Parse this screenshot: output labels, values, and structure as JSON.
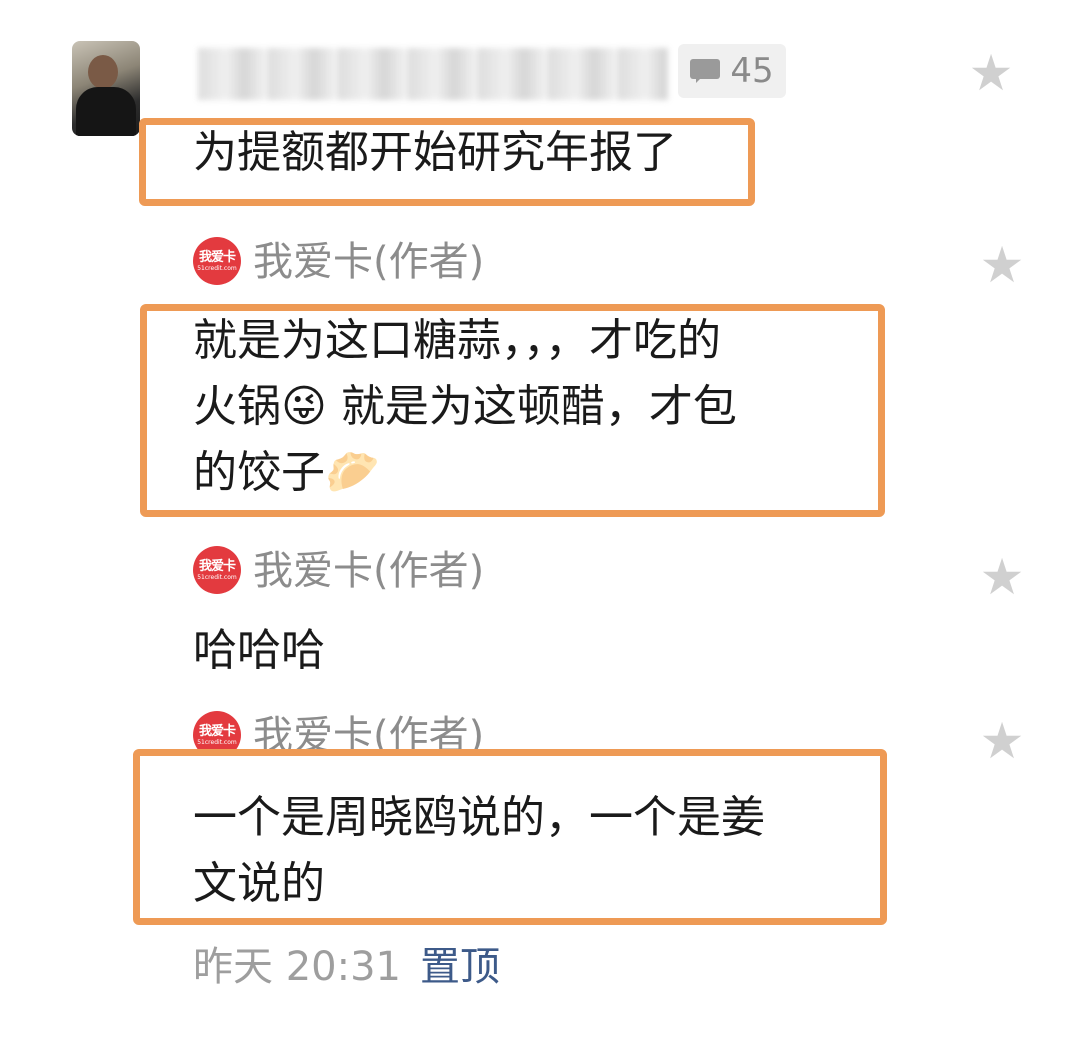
{
  "first_comment": {
    "reply_count": "45",
    "text": "为提额都开始研究年报了"
  },
  "replies": [
    {
      "author": "我爱卡(作者)",
      "avatar_logo": "我爱卡",
      "avatar_domain": "51credit.com",
      "text": "就是为这口糖蒜，，，才吃的\n火锅😜 就是为这顿醋，才包\n的饺子🥟"
    },
    {
      "author": "我爱卡(作者)",
      "avatar_logo": "我爱卡",
      "avatar_domain": "51credit.com",
      "text": "哈哈哈"
    },
    {
      "author": "我爱卡(作者)",
      "avatar_logo": "我爱卡",
      "avatar_domain": "51credit.com",
      "text": "一个是周晓鸥说的，一个是姜\n文说的"
    }
  ],
  "footer": {
    "time": "昨天 20:31",
    "pin_label": "置顶"
  },
  "colors": {
    "highlight": "#ee9a55",
    "author_avatar": "#e33a3f",
    "pin_link": "#3d5a89"
  }
}
